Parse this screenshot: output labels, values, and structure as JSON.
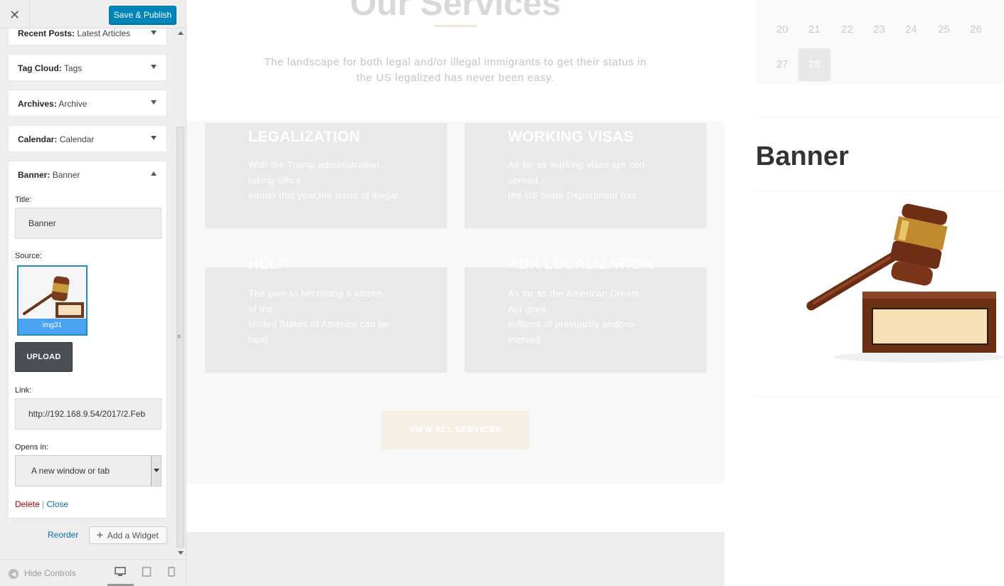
{
  "sidebar": {
    "close_icon": "close-icon",
    "publish_label": "Save & Publish",
    "widgets": [
      {
        "type": "Recent Posts:",
        "title": "Latest Articles"
      },
      {
        "type": "Tag Cloud:",
        "title": "Tags"
      },
      {
        "type": "Archives:",
        "title": "Archive"
      },
      {
        "type": "Calendar:",
        "title": "Calendar"
      },
      {
        "type": "Banner:",
        "title": "Banner"
      }
    ],
    "form": {
      "title_label": "Title:",
      "title_value": "Banner",
      "source_label": "Source:",
      "image_caption": "img31",
      "upload_label": "UPLOAD",
      "link_label": "Link:",
      "link_value": "http://192.168.9.54/2017/2.Feb",
      "opens_label": "Opens in:",
      "opens_value": "A new window or tab",
      "delete_label": "Delete",
      "separator": "|",
      "close_label": "Close"
    },
    "reorder_label": "Reorder",
    "add_widget_label": "Add a Widget",
    "hide_controls_label": "Hide Controls",
    "devices": [
      "desktop-icon",
      "tablet-icon",
      "mobile-icon"
    ]
  },
  "preview": {
    "services_title": "Our Services",
    "services_desc": "The landscape for both legal and/or illegal immigrants to get their status in the US legalized has never been easy.",
    "cards": [
      {
        "title": "LEGALIZATION",
        "lines": [
          "With the Trump administration",
          "taking office",
          "earlier this year,the issue of illegal"
        ]
      },
      {
        "title": "WORKING VISAS",
        "lines": [
          "As far as working visas are con-",
          "cerned,",
          "the US State Department has"
        ]
      },
      {
        "title": "HELP",
        "ghost_title": "...",
        "lines": [
          "The path to becoming a citizen",
          "of the",
          "United States of America can be",
          "hard"
        ]
      },
      {
        "title": "ADA LEGALIZATION",
        "lines": [
          "As far as the American Dream",
          "Act goes,",
          "millions of previously undocu-",
          "mented"
        ]
      }
    ],
    "view_all_label": "VIEW ALL SERVICES",
    "calendar": {
      "row1": [
        "20",
        "21",
        "22",
        "23",
        "24",
        "25",
        "26"
      ],
      "row2": [
        "27",
        "28"
      ],
      "today": "28"
    },
    "banner_heading": "Banner"
  },
  "colors": {
    "accent": "#0085ba",
    "delete": "#aa0000",
    "link": "#0073aa"
  }
}
